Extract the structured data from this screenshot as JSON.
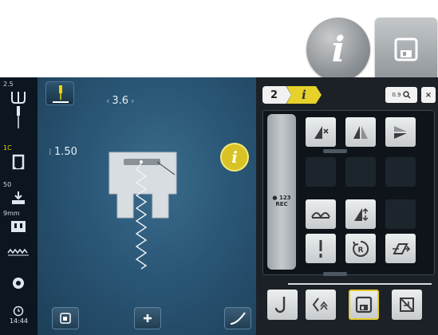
{
  "header_buttons": {
    "info_label": "i"
  },
  "left_bar": {
    "needle_value": "2.5",
    "position_value": "1C",
    "presser_value": "50",
    "feed_value": "9mm",
    "time": "14:44"
  },
  "stitch_view": {
    "stitch_width": "3.6",
    "stitch_length": "1.50",
    "info_label": "i"
  },
  "panel": {
    "breadcrumb": [
      "2",
      "i"
    ],
    "zoom_label": "0.9",
    "close_label": "×",
    "rec_label": "REC",
    "rec_small": "123"
  },
  "colors": {
    "screen_bg": "#153043",
    "accent_yellow": "#e6cc2c",
    "panel_bg": "#1b2126"
  },
  "icons": [
    "info-icon",
    "save-icon",
    "needle-stop-icon",
    "stitch-width-icon",
    "stitch-length-icon",
    "mirror-horizontal-icon",
    "mirror-vertical-icon",
    "balance-icon",
    "pattern-end-icon",
    "pattern-extend-icon",
    "rotate-icon",
    "tie-off-icon",
    "back-step-icon",
    "memory-save-icon",
    "delete-icon",
    "needle-icon",
    "presser-foot-icon",
    "feed-dog-icon",
    "clock-icon"
  ]
}
